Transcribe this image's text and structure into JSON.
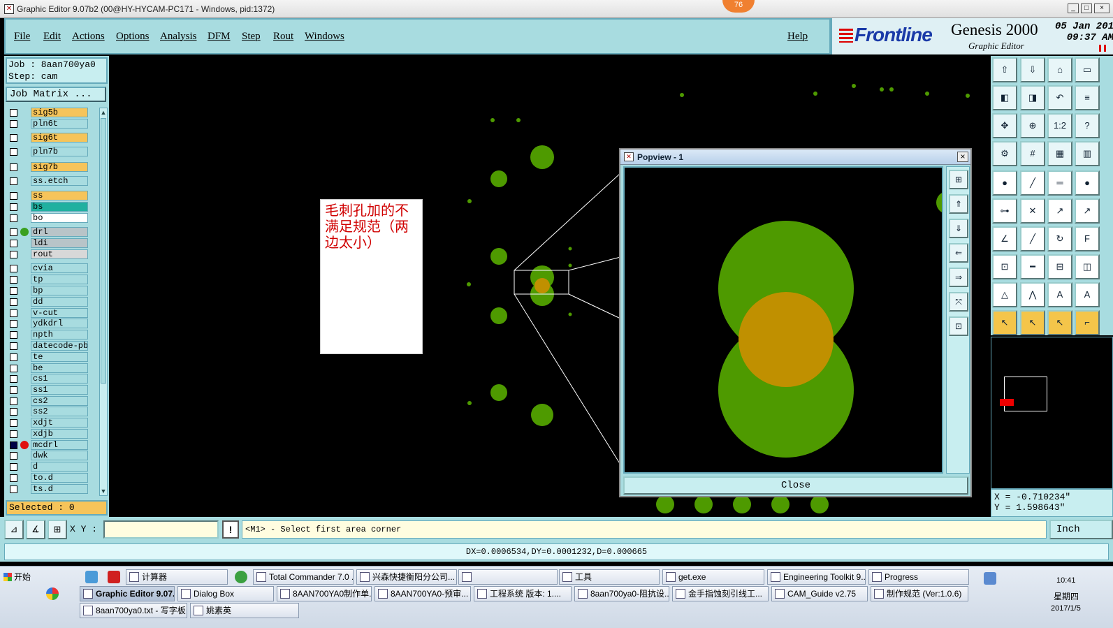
{
  "window": {
    "title": "Graphic Editor 9.07b2 (00@HY-HYCAM-PC171 - Windows, pid:1372)",
    "badge": "76",
    "controls": [
      "_",
      "□",
      "×"
    ]
  },
  "menu": {
    "items": [
      "File",
      "Edit",
      "Actions",
      "Options",
      "Analysis",
      "DFM",
      "Step",
      "Rout",
      "Windows"
    ],
    "help": "Help"
  },
  "brand": {
    "logo": "Frontline",
    "product": "Genesis 2000",
    "subtitle": "Graphic Editor",
    "date": "05 Jan 201",
    "time": "09:37 AM"
  },
  "job": {
    "job_label": "Job : 8aan700ya0",
    "step_label": "Step: cam",
    "matrix_button": "Job Matrix ..."
  },
  "layers": [
    {
      "name": "sig5b",
      "color": "#f6c45a",
      "checked": false,
      "dot": ""
    },
    {
      "name": "pln6t",
      "color": "#a8dce0",
      "checked": false,
      "dot": ""
    },
    {
      "name": "sig6t",
      "color": "#f6c45a",
      "checked": false,
      "dot": ""
    },
    {
      "name": "pln7b",
      "color": "#a8dce0",
      "checked": false,
      "dot": ""
    },
    {
      "name": "sig7b",
      "color": "#f6c45a",
      "checked": false,
      "dot": ""
    },
    {
      "name": "ss.etch",
      "color": "#a8dce0",
      "checked": false,
      "dot": ""
    },
    {
      "name": "ss",
      "color": "#f6c45a",
      "checked": false,
      "dot": ""
    },
    {
      "name": "bs",
      "color": "#20b0a0",
      "checked": false,
      "dot": ""
    },
    {
      "name": "bo",
      "color": "#ffffff",
      "checked": false,
      "dot": ""
    },
    {
      "name": "drl",
      "color": "#b8c4c8",
      "checked": false,
      "dot": "#3aa020"
    },
    {
      "name": "ldi",
      "color": "#b8c4c8",
      "checked": false,
      "dot": ""
    },
    {
      "name": "rout",
      "color": "#d8d8d8",
      "checked": false,
      "dot": ""
    },
    {
      "name": "cvia",
      "color": "#a8dce0",
      "checked": false,
      "dot": ""
    },
    {
      "name": "tp",
      "color": "#a8dce0",
      "checked": false,
      "dot": ""
    },
    {
      "name": "bp",
      "color": "#a8dce0",
      "checked": false,
      "dot": ""
    },
    {
      "name": "dd",
      "color": "#a8dce0",
      "checked": false,
      "dot": ""
    },
    {
      "name": "v-cut",
      "color": "#a8dce0",
      "checked": false,
      "dot": ""
    },
    {
      "name": "ydkdrl",
      "color": "#a8dce0",
      "checked": false,
      "dot": ""
    },
    {
      "name": "npth",
      "color": "#a8dce0",
      "checked": false,
      "dot": ""
    },
    {
      "name": "datecode-pb",
      "color": "#a8dce0",
      "checked": false,
      "dot": ""
    },
    {
      "name": "te",
      "color": "#a8dce0",
      "checked": false,
      "dot": ""
    },
    {
      "name": "be",
      "color": "#a8dce0",
      "checked": false,
      "dot": ""
    },
    {
      "name": "cs1",
      "color": "#a8dce0",
      "checked": false,
      "dot": ""
    },
    {
      "name": "ss1",
      "color": "#a8dce0",
      "checked": false,
      "dot": ""
    },
    {
      "name": "cs2",
      "color": "#a8dce0",
      "checked": false,
      "dot": ""
    },
    {
      "name": "ss2",
      "color": "#a8dce0",
      "checked": false,
      "dot": ""
    },
    {
      "name": "xdjt",
      "color": "#a8dce0",
      "checked": false,
      "dot": ""
    },
    {
      "name": "xdjb",
      "color": "#a8dce0",
      "checked": false,
      "dot": ""
    },
    {
      "name": "mcdrl",
      "color": "#a8dce0",
      "checked": true,
      "dot": "#e01010"
    },
    {
      "name": "dwk",
      "color": "#a8dce0",
      "checked": false,
      "dot": ""
    },
    {
      "name": "d",
      "color": "#a8dce0",
      "checked": false,
      "dot": ""
    },
    {
      "name": "to.d",
      "color": "#a8dce0",
      "checked": false,
      "dot": ""
    },
    {
      "name": "ts.d",
      "color": "#a8dce0",
      "checked": false,
      "dot": ""
    }
  ],
  "selected_label": "Selected : 0",
  "annotation": "毛刺孔加的不满足规范（两边太小）",
  "popview": {
    "title": "Popview - 1",
    "close": "Close",
    "close_x": "×"
  },
  "coords": {
    "x": "X = -0.710234\"",
    "y": "Y =  1.598643\""
  },
  "command": {
    "xy_label": "X Y :",
    "xy_value": "",
    "exclaim": "!",
    "message": "<M1> - Select first area corner",
    "unit": "Inch"
  },
  "status": "DX=0.0006534,DY=0.0001232,D=0.000665",
  "colors": {
    "pad_green": "#4e9a00",
    "drill_gold": "#c09000",
    "panel": "#a8dce0"
  },
  "taskbar": {
    "start": "开始",
    "row1": [
      {
        "label": "计算器"
      },
      {
        "label": "Total Commander 7.0 ..."
      },
      {
        "label": "兴森快捷衡阳分公司..."
      },
      {
        "label": ""
      },
      {
        "label": "工具"
      },
      {
        "label": "get.exe"
      },
      {
        "label": "Engineering Toolkit 9...."
      },
      {
        "label": "Progress"
      }
    ],
    "row2": [
      {
        "label": "Graphic Editor 9.07..."
      },
      {
        "label": "Dialog Box"
      },
      {
        "label": "8AAN700YA0制作单..."
      },
      {
        "label": "8AAN700YA0-预审..."
      },
      {
        "label": "工程系统  版本: 1...."
      },
      {
        "label": "8aan700ya0-阻抗设..."
      },
      {
        "label": "金手指蚀刻引线工..."
      },
      {
        "label": "CAM_Guide v2.75"
      },
      {
        "label": "制作规范 (Ver:1.0.6)"
      }
    ],
    "row3": [
      {
        "label": "8aan700ya0.txt - 写字板"
      },
      {
        "label": "姚素英"
      }
    ],
    "clock": "10:41",
    "weekday": "星期四",
    "date": "2017/1/5"
  }
}
